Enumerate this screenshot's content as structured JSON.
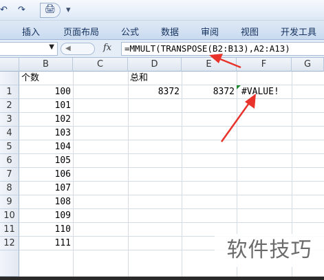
{
  "quick_access": {
    "undo": "↶",
    "redo": "↷",
    "print": "🖨",
    "customize": "▾"
  },
  "ribbon_tabs": [
    "插入",
    "页面布局",
    "公式",
    "数据",
    "审阅",
    "视图",
    "开发工具"
  ],
  "formula_bar": {
    "namebox_value": "",
    "fx_label": "fx",
    "formula": "=MMULT(TRANSPOSE(B2:B13),A2:A13)"
  },
  "columns": [
    "B",
    "C",
    "D",
    "E",
    "F",
    "G"
  ],
  "rows": [
    "",
    "1",
    "2",
    "3",
    "4",
    "5",
    "6",
    "7",
    "8",
    "9",
    "10",
    "11",
    "12"
  ],
  "cells": {
    "B_header": "个数",
    "D_header": "总和",
    "B_values": [
      "100",
      "101",
      "102",
      "103",
      "104",
      "105",
      "106",
      "107",
      "108",
      "109",
      "110",
      "111"
    ],
    "D1": "8372",
    "E1": "8372",
    "F1": "#VALUE!"
  },
  "annotation_color": "#e8322a",
  "watermark": "软件技巧"
}
